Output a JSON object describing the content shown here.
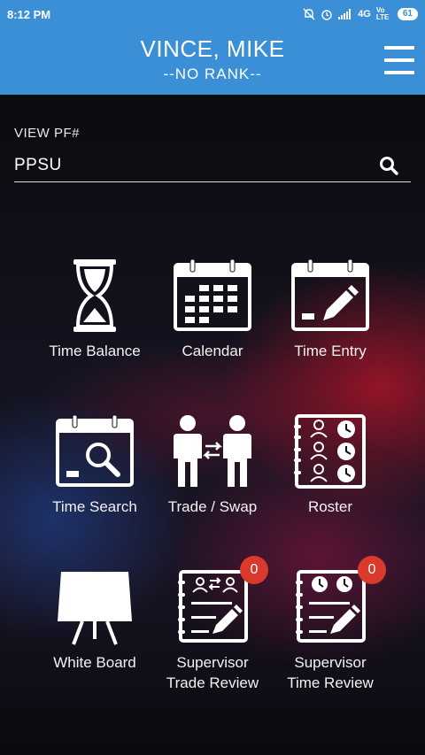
{
  "status_bar": {
    "time": "8:12 PM",
    "network": "4G",
    "volte": "Vo LTE",
    "battery": "61"
  },
  "header": {
    "name": "VINCE, MIKE",
    "rank": "--NO RANK--"
  },
  "search": {
    "label": "VIEW PF#",
    "value": "PPSU"
  },
  "tiles": [
    {
      "label": "Time Balance",
      "icon": "hourglass-icon"
    },
    {
      "label": "Calendar",
      "icon": "calendar-icon"
    },
    {
      "label": "Time Entry",
      "icon": "calendar-pencil-icon"
    },
    {
      "label": "Time Search",
      "icon": "calendar-search-icon"
    },
    {
      "label": "Trade / Swap",
      "icon": "trade-swap-icon"
    },
    {
      "label": "Roster",
      "icon": "roster-icon"
    },
    {
      "label": "White Board",
      "icon": "whiteboard-icon"
    },
    {
      "label_line1": "Supervisor",
      "label_line2": "Trade Review",
      "icon": "trade-review-icon",
      "badge": "0"
    },
    {
      "label_line1": "Supervisor",
      "label_line2": "Time Review",
      "icon": "time-review-icon",
      "badge": "0"
    }
  ],
  "colors": {
    "header_blue": "#3a8fd6",
    "badge_red": "#d93a2b"
  }
}
